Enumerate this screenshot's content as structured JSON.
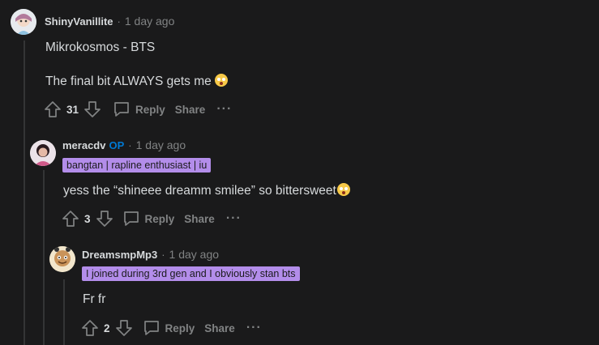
{
  "comments": [
    {
      "author": "ShinyVanillite",
      "op": "",
      "dot": "·",
      "time": "1 day ago",
      "flair": "",
      "lines": [
        "Mikrokosmos - BTS",
        "The final bit ALWAYS gets me"
      ],
      "votes": "31",
      "reply_label": "Reply",
      "share_label": "Share",
      "more_label": "···"
    },
    {
      "author": "meracdv",
      "op": "OP",
      "dot": "·",
      "time": "1 day ago",
      "flair": "bangtan | rapline enthusiast | iu",
      "lines": [
        "yess the “shineee dreamm smilee” so bittersweet"
      ],
      "votes": "3",
      "reply_label": "Reply",
      "share_label": "Share",
      "more_label": "···"
    },
    {
      "author": "DreamsmpMp3",
      "op": "",
      "dot": "·",
      "time": "1 day ago",
      "flair": "I joined during 3rd gen and I obviously stan bts",
      "lines": [
        "Fr fr"
      ],
      "votes": "2",
      "reply_label": "Reply",
      "share_label": "Share",
      "more_label": "···"
    }
  ],
  "colors": {
    "background": "#1a1a1b",
    "text": "#d7dadc",
    "muted": "#818384",
    "op": "#0079d3",
    "flair": "#b38dea",
    "thread_line": "#343536"
  },
  "icons": {
    "upvote": "upvote-arrow-icon",
    "downvote": "downvote-arrow-icon",
    "reply": "reply-bubble-icon",
    "emoji": "crying-face-emoji-icon"
  }
}
